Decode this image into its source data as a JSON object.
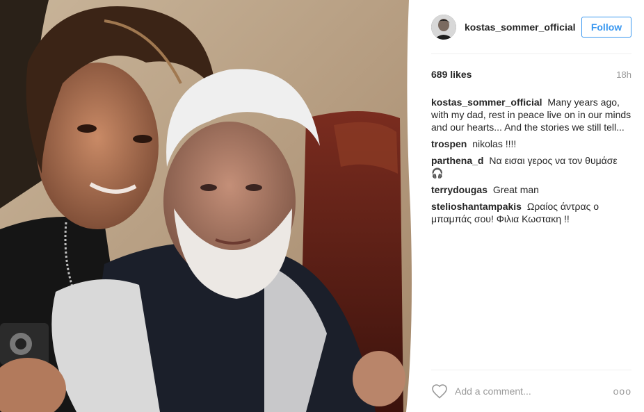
{
  "post": {
    "username": "kostas_sommer_official",
    "follow_label": "Follow",
    "likes": "689 likes",
    "time_ago": "18h",
    "caption": {
      "user": "kostas_sommer_official",
      "text": "Many years ago, with my dad, rest in peace live on in our minds and our hearts... And the stories we still tell..."
    },
    "comments": [
      {
        "user": "trospen",
        "text": "nikolas !!!!"
      },
      {
        "user": "parthena_d",
        "text": "Να εισαι γερος να τον θυμάσε 🎧"
      },
      {
        "user": "terrydougas",
        "text": "Great man"
      },
      {
        "user": "stelioshantampakis",
        "text": "Ωραίος άντρας ο μπαμπάς σου! Φιλια Κωστακη !!"
      }
    ],
    "add_comment_placeholder": "Add a comment...",
    "more_label": "ooo",
    "icons": {
      "like": "heart-outline-icon",
      "more": "more-options-icon"
    },
    "colors": {
      "accent": "#3897f0",
      "muted": "#999999",
      "divider": "#efefef"
    }
  }
}
